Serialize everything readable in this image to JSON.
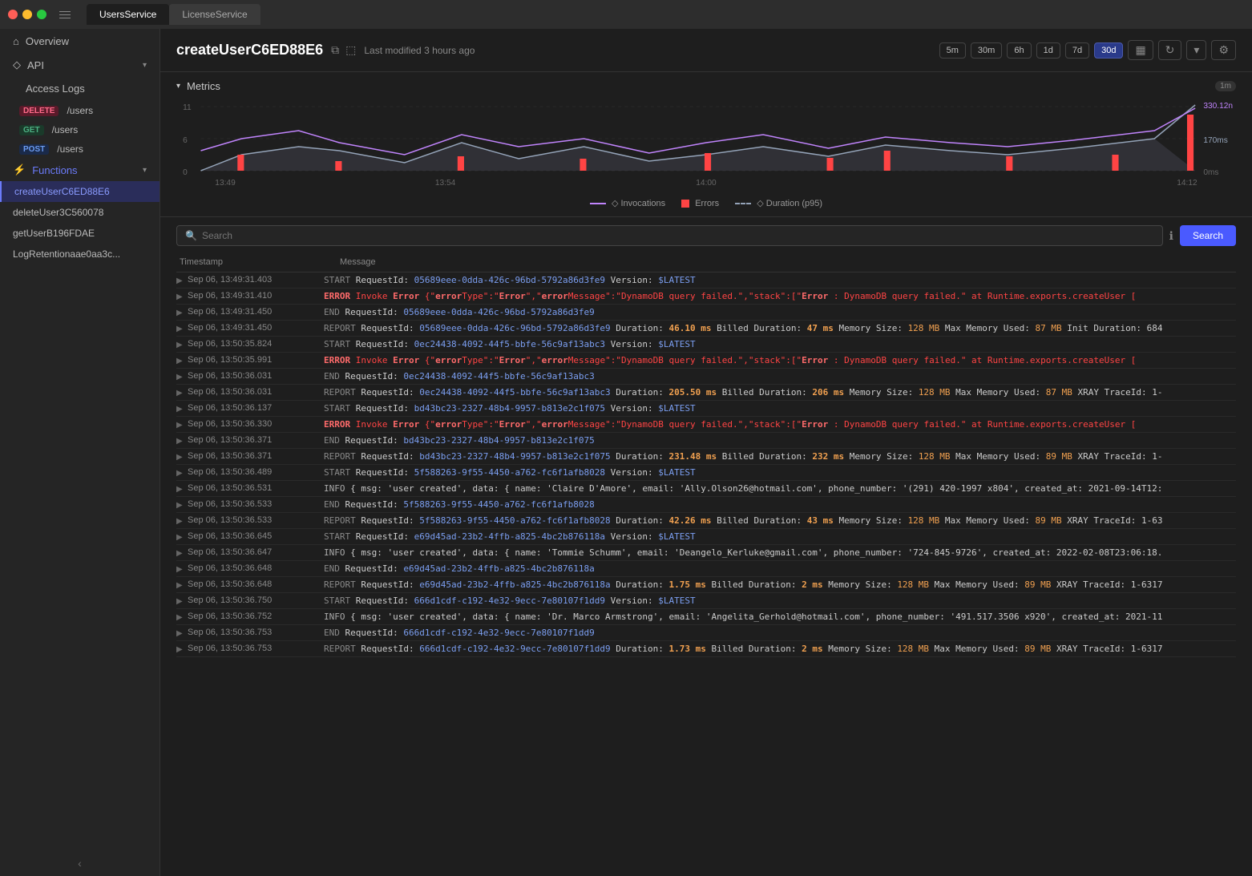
{
  "titlebar": {
    "tabs": [
      {
        "id": "users",
        "label": "UsersService",
        "active": true
      },
      {
        "id": "license",
        "label": "LicenseService",
        "active": false
      }
    ]
  },
  "sidebar": {
    "overview_label": "Overview",
    "api_label": "API",
    "access_logs_label": "Access Logs",
    "api_items": [
      {
        "method": "DELETE",
        "method_class": "api-delete",
        "path": "/users"
      },
      {
        "method": "GET",
        "method_class": "api-get",
        "path": "/users"
      },
      {
        "method": "POST",
        "method_class": "api-post",
        "path": "/users"
      }
    ],
    "functions_label": "Functions",
    "functions": [
      {
        "id": "createUserC6ED88E6",
        "label": "createUserC6ED88E6",
        "active": true
      },
      {
        "id": "deleteUser3C560078",
        "label": "deleteUser3C560078",
        "active": false
      },
      {
        "id": "getUserB196FDAE",
        "label": "getUserB196FDAE",
        "active": false
      },
      {
        "id": "LogRetentionaae0aa3c",
        "label": "LogRetentionaae0aa3c...",
        "active": false
      }
    ],
    "collapse_icon": "‹"
  },
  "header": {
    "title": "createUserC6ED88E6",
    "last_modified": "Last modified 3 hours ago",
    "time_options": [
      "5m",
      "30m",
      "6h",
      "1d",
      "7d",
      "30d"
    ],
    "active_time": "30d"
  },
  "metrics": {
    "section_label": "Metrics",
    "badge": "1m",
    "y_labels": [
      "11",
      "6",
      "0"
    ],
    "x_labels": [
      "13:49",
      "13:54",
      "14:00",
      "14:12"
    ],
    "right_labels": [
      "330.12n",
      "170ms",
      "0ms"
    ],
    "legend": [
      {
        "type": "line",
        "color": "#c084fc",
        "label": "Invocations"
      },
      {
        "type": "bar",
        "color": "#ff4444",
        "label": "Errors"
      },
      {
        "type": "line",
        "color": "#94a3b8",
        "label": "Duration (p95)"
      }
    ]
  },
  "logs": {
    "search_placeholder": "Search",
    "search_btn": "Search",
    "col_timestamp": "Timestamp",
    "col_message": "Message",
    "rows": [
      {
        "timestamp": "Sep 06, 13:49:31.403",
        "type": "start",
        "message": "START RequestId: 05689eee-0dda-426c-96bd-5792a86d3fe9 Version: $LATEST"
      },
      {
        "timestamp": "Sep 06, 13:49:31.410",
        "type": "error",
        "message": "ERROR Invoke Error {\"error\"Type\":\"Error\",\"errorMessage\":\"DynamoDB query failed.\",\"stack\":[\"Error : DynamoDB query failed.\" at Runtime.exports.createUser ["
      },
      {
        "timestamp": "Sep 06, 13:49:31.450",
        "type": "end",
        "message": "END RequestId: 05689eee-0dda-426c-96bd-5792a86d3fe9"
      },
      {
        "timestamp": "Sep 06, 13:49:31.450",
        "type": "report",
        "message": "REPORT RequestId: 05689eee-0dda-426c-96bd-5792a86d3fe9 Duration: 46.10 ms Billed Duration: 47 ms Memory Size: 128 MB Max Memory Used: 87 MB Init Duration: 684"
      },
      {
        "timestamp": "Sep 06, 13:50:35.824",
        "type": "start",
        "message": "START RequestId: 0ec24438-4092-44f5-bbfe-56c9af13abc3 Version: $LATEST"
      },
      {
        "timestamp": "Sep 06, 13:50:35.991",
        "type": "error",
        "message": "ERROR Invoke Error {\"error\"Type\":\"Error\",\"errorMessage\":\"DynamoDB query failed.\",\"stack\":[\"Error : DynamoDB query failed.\" at Runtime.exports.createUser ["
      },
      {
        "timestamp": "Sep 06, 13:50:36.031",
        "type": "end",
        "message": "END RequestId: 0ec24438-4092-44f5-bbfe-56c9af13abc3"
      },
      {
        "timestamp": "Sep 06, 13:50:36.031",
        "type": "report",
        "message": "REPORT RequestId: 0ec24438-4092-44f5-bbfe-56c9af13abc3 Duration: 205.50 ms Billed Duration: 206 ms Memory Size: 128 MB Max Memory Used: 87 MB XRAY TraceId: 1-"
      },
      {
        "timestamp": "Sep 06, 13:50:36.137",
        "type": "start",
        "message": "START RequestId: bd43bc23-2327-48b4-9957-b813e2c1f075 Version: $LATEST"
      },
      {
        "timestamp": "Sep 06, 13:50:36.330",
        "type": "error",
        "message": "ERROR Invoke Error {\"error\"Type\":\"Error\",\"errorMessage\":\"DynamoDB query failed.\",\"stack\":[\"Error : DynamoDB query failed.\" at Runtime.exports.createUser ["
      },
      {
        "timestamp": "Sep 06, 13:50:36.371",
        "type": "end",
        "message": "END RequestId: bd43bc23-2327-48b4-9957-b813e2c1f075"
      },
      {
        "timestamp": "Sep 06, 13:50:36.371",
        "type": "report",
        "message": "REPORT RequestId: bd43bc23-2327-48b4-9957-b813e2c1f075 Duration: 231.48 ms Billed Duration: 232 ms Memory Size: 128 MB Max Memory Used: 89 MB XRAY TraceId: 1-"
      },
      {
        "timestamp": "Sep 06, 13:50:36.489",
        "type": "start",
        "message": "START RequestId: 5f588263-9f55-4450-a762-fc6f1afb8028 Version: $LATEST"
      },
      {
        "timestamp": "Sep 06, 13:50:36.531",
        "type": "info",
        "message": "INFO { msg: 'user created', data: { name: 'Claire D'Amore', email: 'Ally.Olson26@hotmail.com', phone_number: '(291) 420-1997 x804', created_at: 2021-09-14T12:"
      },
      {
        "timestamp": "Sep 06, 13:50:36.533",
        "type": "end",
        "message": "END RequestId: 5f588263-9f55-4450-a762-fc6f1afb8028"
      },
      {
        "timestamp": "Sep 06, 13:50:36.533",
        "type": "report",
        "message": "REPORT RequestId: 5f588263-9f55-4450-a762-fc6f1afb8028 Duration: 42.26 ms Billed Duration: 43 ms Memory Size: 128 MB Max Memory Used: 89 MB XRAY TraceId: 1-63"
      },
      {
        "timestamp": "Sep 06, 13:50:36.645",
        "type": "start",
        "message": "START RequestId: e69d45ad-23b2-4ffb-a825-4bc2b876118a Version: $LATEST"
      },
      {
        "timestamp": "Sep 06, 13:50:36.647",
        "type": "info",
        "message": "INFO { msg: 'user created', data: { name: 'Tommie Schumm', email: 'Deangelo_Kerluke@gmail.com', phone_number: '724-845-9726', created_at: 2022-02-08T23:06:18."
      },
      {
        "timestamp": "Sep 06, 13:50:36.648",
        "type": "end",
        "message": "END RequestId: e69d45ad-23b2-4ffb-a825-4bc2b876118a"
      },
      {
        "timestamp": "Sep 06, 13:50:36.648",
        "type": "report",
        "message": "REPORT RequestId: e69d45ad-23b2-4ffb-a825-4bc2b876118a Duration: 1.75 ms Billed Duration: 2 ms Memory Size: 128 MB Max Memory Used: 89 MB XRAY TraceId: 1-6317"
      },
      {
        "timestamp": "Sep 06, 13:50:36.750",
        "type": "start",
        "message": "START RequestId: 666d1cdf-c192-4e32-9ecc-7e80107f1dd9 Version: $LATEST"
      },
      {
        "timestamp": "Sep 06, 13:50:36.752",
        "type": "info",
        "message": "INFO { msg: 'user created', data: { name: 'Dr. Marco Armstrong', email: 'Angelita_Gerhold@hotmail.com', phone_number: '491.517.3506 x920', created_at: 2021-11"
      },
      {
        "timestamp": "Sep 06, 13:50:36.753",
        "type": "end",
        "message": "END RequestId: 666d1cdf-c192-4e32-9ecc-7e80107f1dd9"
      },
      {
        "timestamp": "Sep 06, 13:50:36.753",
        "type": "report",
        "message": "REPORT RequestId: 666d1cdf-c192-4e32-9ecc-7e80107f1dd9 Duration: 1.73 ms Billed Duration: 2 ms Memory Size: 128 MB Max Memory Used: 89 MB XRAY TraceId: 1-6317"
      }
    ]
  }
}
